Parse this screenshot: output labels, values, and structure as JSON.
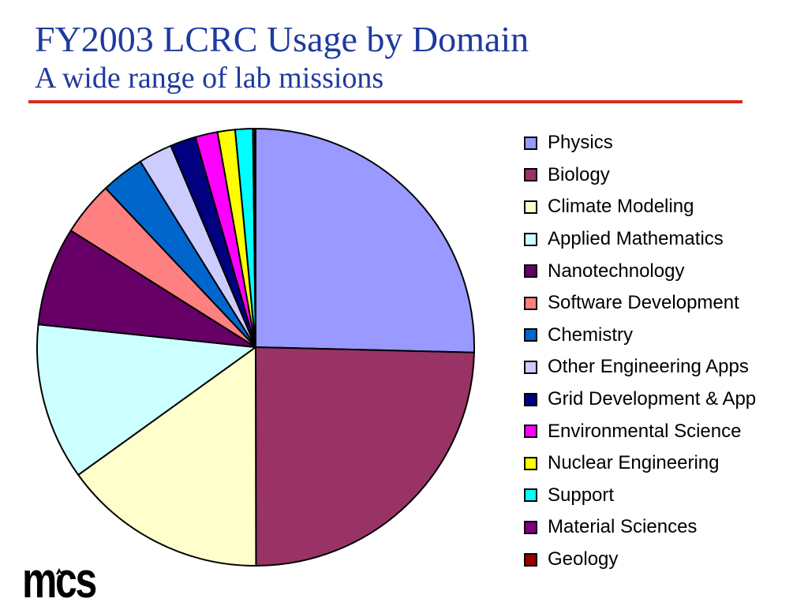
{
  "header": {
    "title": "FY2003 LCRC Usage by Domain",
    "subtitle": "A wide range of lab missions"
  },
  "theme": {
    "title_color": "#1F3A9E",
    "subtitle_color": "#1F3A9E",
    "rule_color": "#D42B1E",
    "slice_border_color": "#000000",
    "background_color": "#FFFFFF"
  },
  "footer": {
    "logo_text": "mcs"
  },
  "chart_data": {
    "type": "pie",
    "title": "FY2003 LCRC Usage by Domain",
    "start_angle_deg": 0,
    "direction": "clockwise",
    "legend_position": "right",
    "unit": "percent (estimated from slice angles)",
    "series": [
      {
        "name": "Physics",
        "value": 25.4,
        "color": "#9999FF"
      },
      {
        "name": "Biology",
        "value": 24.6,
        "color": "#993366"
      },
      {
        "name": "Climate Modeling",
        "value": 15.1,
        "color": "#FFFFCC"
      },
      {
        "name": "Applied Mathematics",
        "value": 11.6,
        "color": "#CCFFFF"
      },
      {
        "name": "Nanotechnology",
        "value": 7.3,
        "color": "#660066"
      },
      {
        "name": "Software Development",
        "value": 4.0,
        "color": "#FF8080"
      },
      {
        "name": "Chemistry",
        "value": 3.2,
        "color": "#0066CC"
      },
      {
        "name": "Other Engineering Apps",
        "value": 2.5,
        "color": "#CCCCFF"
      },
      {
        "name": "Grid Development & App",
        "value": 1.9,
        "color": "#000080"
      },
      {
        "name": "Environmental Science",
        "value": 1.65,
        "color": "#FF00FF"
      },
      {
        "name": "Nuclear Engineering",
        "value": 1.3,
        "color": "#FFFF00"
      },
      {
        "name": "Support",
        "value": 1.3,
        "color": "#00FFFF"
      },
      {
        "name": "Material Sciences",
        "value": 0.15,
        "color": "#800080"
      },
      {
        "name": "Geology",
        "value": 0.05,
        "color": "#990000"
      }
    ]
  }
}
